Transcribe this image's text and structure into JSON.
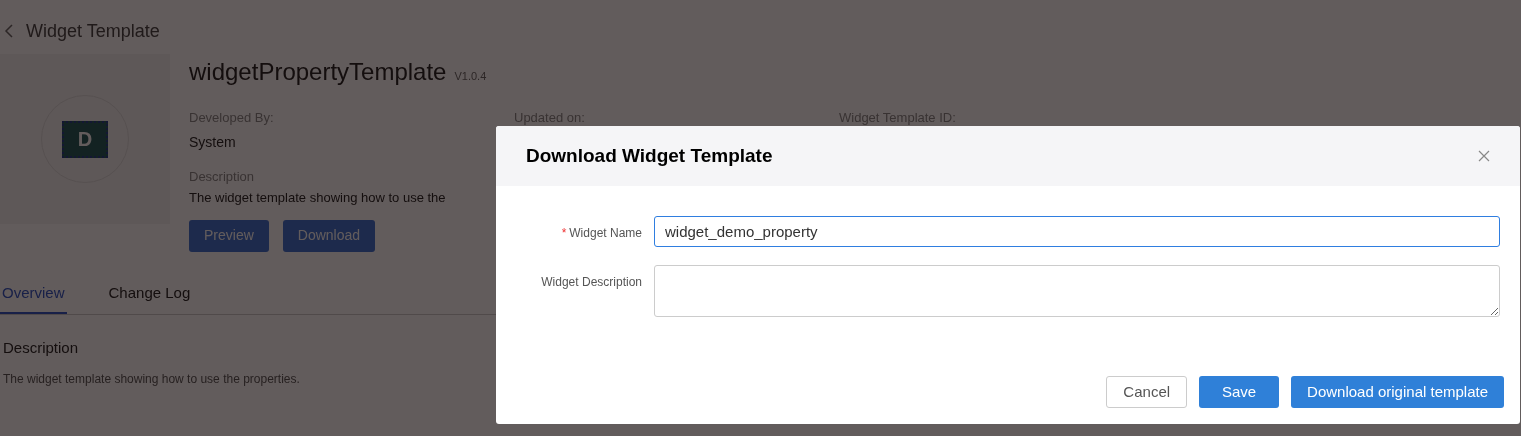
{
  "page": {
    "title": "Widget Template",
    "avatar_letter": "D",
    "name": "widgetPropertyTemplate",
    "version": "V1.0.4",
    "fields": [
      {
        "label": "Developed By:",
        "value": "System"
      },
      {
        "label": "Updated on:"
      },
      {
        "label": "Widget Template ID:"
      }
    ],
    "description_label": "Description",
    "description": "The widget template showing how to use the",
    "buttons": [
      "Preview",
      "Download"
    ],
    "tabs": [
      {
        "label": "Overview",
        "selected": true
      },
      {
        "label": "Change Log",
        "selected": false
      }
    ],
    "section_title": "Description",
    "section_text": "The widget template showing how to use the properties."
  },
  "dialog": {
    "title": "Download Widget Template",
    "required_mark": "*",
    "fields": [
      {
        "kind": "input",
        "label": "Widget Name",
        "required": true,
        "value": "widget_demo_property"
      },
      {
        "kind": "textarea",
        "label": "Widget Description",
        "required": false
      }
    ],
    "buttons": [
      {
        "label": "Cancel",
        "kind": "secondary"
      },
      {
        "label": "Save",
        "kind": "primary"
      },
      {
        "label": "Download original template",
        "kind": "primary"
      }
    ]
  }
}
